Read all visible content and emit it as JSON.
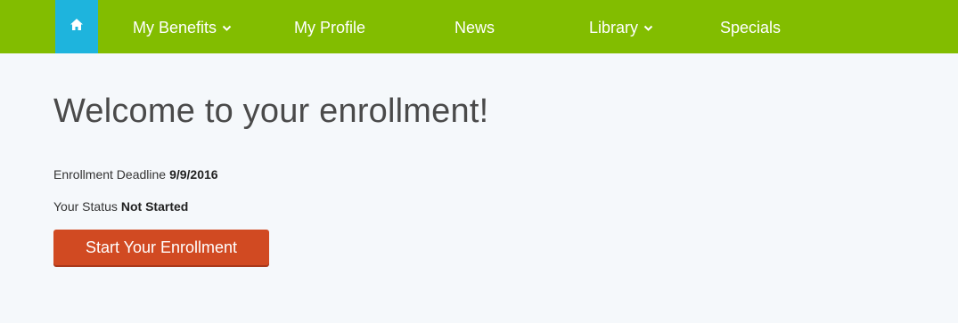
{
  "nav": {
    "home_icon": "home-icon",
    "items": [
      {
        "label": "My Benefits",
        "has_dropdown": true
      },
      {
        "label": "My Profile",
        "has_dropdown": false
      },
      {
        "label": "News",
        "has_dropdown": false
      },
      {
        "label": "Library",
        "has_dropdown": true
      },
      {
        "label": "Specials",
        "has_dropdown": false
      }
    ]
  },
  "main": {
    "title": "Welcome to your enrollment!",
    "deadline_label": "Enrollment Deadline",
    "deadline_value": "9/9/2016",
    "status_label": "Your Status",
    "status_value": "Not Started",
    "start_button_label": "Start Your Enrollment"
  },
  "colors": {
    "nav_bg": "#82bd00",
    "home_bg": "#1eb4dd",
    "page_bg": "#f5f8fb",
    "button_bg": "#d14a22"
  }
}
